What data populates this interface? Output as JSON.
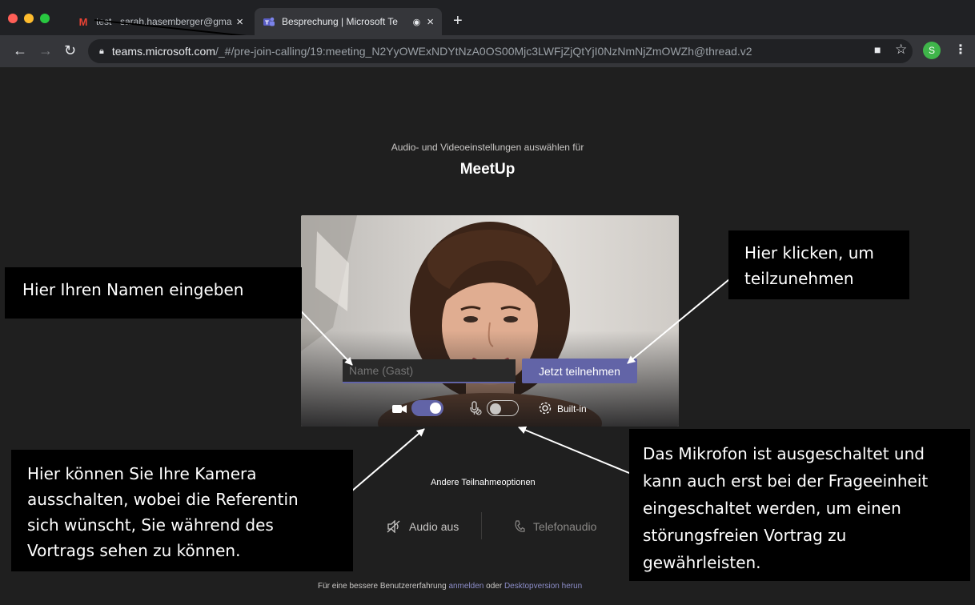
{
  "browser": {
    "tabs": [
      {
        "title": "test - sarah.hasemberger@gma",
        "icon": "gmail-icon",
        "active": false
      },
      {
        "title": "Besprechung | Microsoft Te",
        "icon": "teams-icon",
        "active": true
      }
    ],
    "new_tab_icon": "+",
    "url_host": "teams.microsoft.com",
    "url_path": "/_#/pre-join-calling/19:meeting_N2YyOWExNDYtNzA0OS00Mjc3LWFjZjQtYjI0NzNmNjZmOWZh@thread.v2",
    "profile_initial": "S"
  },
  "prejoin": {
    "subtitle": "Audio- und Videoeinstellungen auswählen für",
    "meeting_title": "MeetUp",
    "name_placeholder": "Name (Gast)",
    "join_button": "Jetzt teilnehmen",
    "camera_on": true,
    "mic_on": false,
    "device_label": "Built-in",
    "other_options_label": "Andere Teilnahmeoptionen",
    "audio_off_label": "Audio aus",
    "phone_audio_label": "Telefonaudio",
    "footer_prefix": "Für eine bessere Benutzererfahrung ",
    "footer_link_signin": "anmelden",
    "footer_middle": " oder ",
    "footer_link_desktop": "Desktopversion herun"
  },
  "annotations": {
    "name_hint": "Hier Ihren Namen eingeben",
    "join_hint_line1": "Hier klicken, um",
    "join_hint_line2": "teilzunehmen",
    "camera_hint": [
      "Hier können Sie Ihre Kamera",
      "ausschalten, wobei die Referentin",
      "sich wünscht, Sie während des",
      "Vortrags sehen zu können."
    ],
    "mic_hint": [
      "Das Mikrofon ist ausgeschaltet und",
      "kann auch erst bei der Frageeinheit",
      "eingeschaltet werden, um einen",
      "störungsfreien Vortrag zu",
      "gewährleisten."
    ]
  },
  "colors": {
    "teams_purple": "#6264a7",
    "background": "#1f1f1f",
    "callout_bg": "#000000"
  }
}
